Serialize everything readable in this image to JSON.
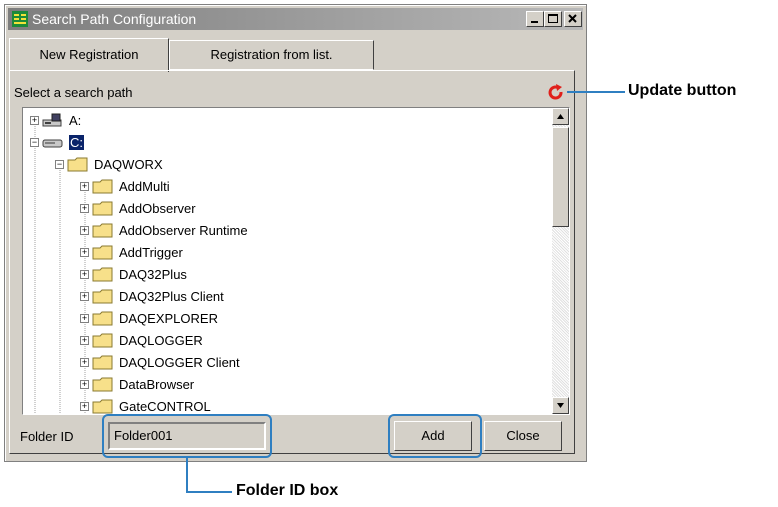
{
  "window": {
    "title": "Search Path Configuration"
  },
  "tabs": [
    {
      "label": "New Registration",
      "active": true
    },
    {
      "label": "Registration from list.",
      "active": false
    }
  ],
  "select_label": "Select a search path",
  "tree": {
    "drives": [
      {
        "label": "A:",
        "icon": "floppy-drive-icon"
      },
      {
        "label": "C:",
        "icon": "hard-drive-icon",
        "selected": true
      }
    ],
    "root_folder": "DAQWORX",
    "folders": [
      "AddMulti",
      "AddObserver",
      "AddObserver Runtime",
      "AddTrigger",
      "DAQ32Plus",
      "DAQ32Plus Client",
      "DAQEXPLORER",
      "DAQLOGGER",
      "DAQLOGGER Client",
      "DataBrowser",
      "GateCONTROL"
    ]
  },
  "folder_id": {
    "label": "Folder ID",
    "value": "Folder001"
  },
  "buttons": {
    "add": "Add",
    "close": "Close"
  },
  "annotations": {
    "update_button": "Update button",
    "folder_id_box": "Folder ID box"
  },
  "colors": {
    "callout": "#2f7fc1",
    "update_icon": "#e0201b",
    "folder": "#f7e08a",
    "selection": "#0a246a"
  }
}
